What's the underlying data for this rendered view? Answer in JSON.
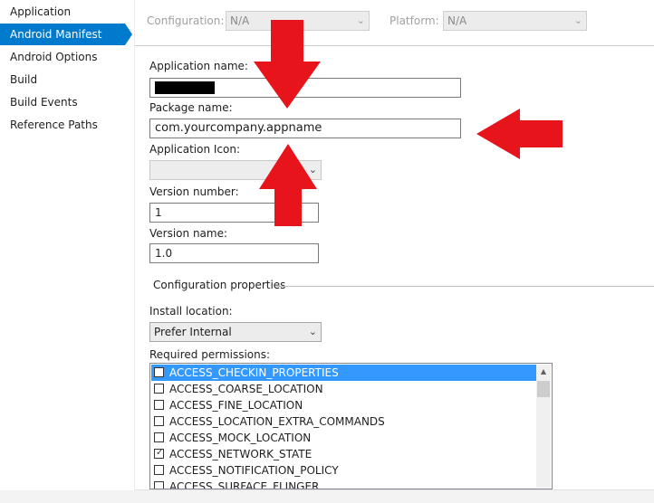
{
  "sidebar": {
    "items": [
      {
        "label": "Application",
        "active": false
      },
      {
        "label": "Android Manifest",
        "active": true
      },
      {
        "label": "Android Options",
        "active": false
      },
      {
        "label": "Build",
        "active": false
      },
      {
        "label": "Build Events",
        "active": false
      },
      {
        "label": "Reference Paths",
        "active": false
      }
    ]
  },
  "config": {
    "configuration_label": "Configuration:",
    "configuration_value": "N/A",
    "platform_label": "Platform:",
    "platform_value": "N/A"
  },
  "form": {
    "app_name_label": "Application name:",
    "package_label": "Package name:",
    "package_value": "com.yourcompany.appname",
    "icon_label": "Application Icon:",
    "version_number_label": "Version number:",
    "version_number_value": "1",
    "version_name_label": "Version name:",
    "version_name_value": "1.0"
  },
  "config_props": {
    "section_title": "Configuration properties",
    "install_location_label": "Install location:",
    "install_location_value": "Prefer Internal",
    "permissions_label": "Required permissions:",
    "permissions": [
      {
        "name": "ACCESS_CHECKIN_PROPERTIES",
        "checked": false,
        "selected": true
      },
      {
        "name": "ACCESS_COARSE_LOCATION",
        "checked": false,
        "selected": false
      },
      {
        "name": "ACCESS_FINE_LOCATION",
        "checked": false,
        "selected": false
      },
      {
        "name": "ACCESS_LOCATION_EXTRA_COMMANDS",
        "checked": false,
        "selected": false
      },
      {
        "name": "ACCESS_MOCK_LOCATION",
        "checked": false,
        "selected": false
      },
      {
        "name": "ACCESS_NETWORK_STATE",
        "checked": true,
        "selected": false
      },
      {
        "name": "ACCESS_NOTIFICATION_POLICY",
        "checked": false,
        "selected": false
      },
      {
        "name": "ACCESS_SURFACE_FLINGER",
        "checked": false,
        "selected": false
      }
    ]
  },
  "colors": {
    "accent": "#007acc",
    "selection": "#3399ff",
    "annotation_red": "#e8141c"
  }
}
